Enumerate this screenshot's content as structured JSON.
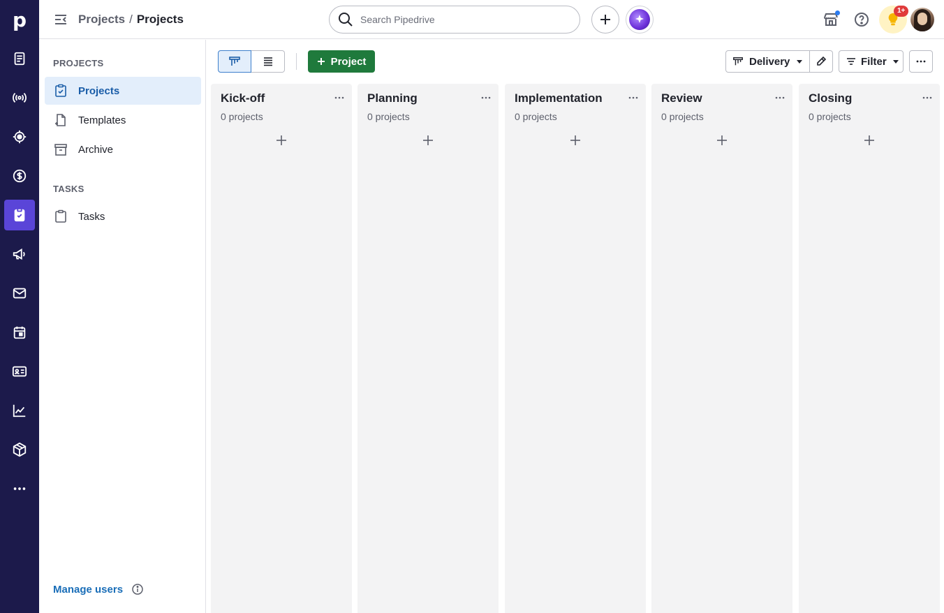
{
  "topbar": {
    "breadcrumb": [
      "Projects",
      "Projects"
    ],
    "breadcrumb_separator": "/",
    "search_placeholder": "Search Pipedrive",
    "notification_badge": "1+"
  },
  "rail": {
    "items": [
      "leads-icon",
      "broadcast-icon",
      "target-icon",
      "deals-icon",
      "projects-icon",
      "campaigns-icon",
      "mail-icon",
      "calendar-icon",
      "contacts-icon",
      "insights-icon",
      "products-icon",
      "more-icon"
    ],
    "active": "projects-icon"
  },
  "sidebar": {
    "projects_section": "PROJECTS",
    "items": [
      {
        "label": "Projects",
        "icon": "projects-board-icon"
      },
      {
        "label": "Templates",
        "icon": "template-icon"
      },
      {
        "label": "Archive",
        "icon": "archive-icon"
      }
    ],
    "tasks_section": "TASKS",
    "tasks_item": {
      "label": "Tasks",
      "icon": "tasks-icon"
    },
    "manage_users": "Manage users"
  },
  "toolbar": {
    "new_project_label": "Project",
    "pipeline": "Delivery",
    "filter_label": "Filter"
  },
  "board": {
    "columns": [
      {
        "title": "Kick-off",
        "count": "0 projects"
      },
      {
        "title": "Planning",
        "count": "0 projects"
      },
      {
        "title": "Implementation",
        "count": "0 projects"
      },
      {
        "title": "Review",
        "count": "0 projects"
      },
      {
        "title": "Closing",
        "count": "0 projects"
      }
    ]
  },
  "colors": {
    "rail_bg": "#1c1a4b",
    "rail_active": "#5a45d8",
    "primary_green": "#1f7a3c",
    "link_blue": "#1a6eb8",
    "active_item_bg": "#e3eefb"
  }
}
